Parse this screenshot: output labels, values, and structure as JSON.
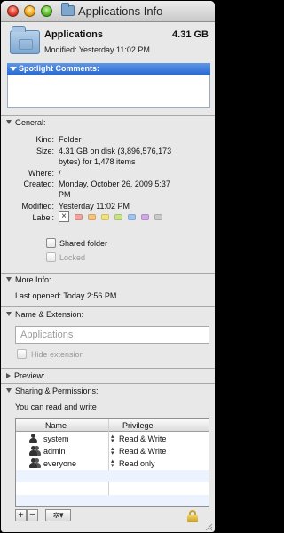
{
  "window": {
    "title": "Applications Info"
  },
  "header": {
    "name": "Applications",
    "size": "4.31 GB",
    "modified": "Modified: Yesterday 11:02 PM"
  },
  "spotlight": {
    "label": "Spotlight Comments:",
    "comment": ""
  },
  "general": {
    "heading": "General:",
    "kind_label": "Kind:",
    "kind": "Folder",
    "size_label": "Size:",
    "size_line1": "4.31 GB on disk (3,896,576,173",
    "size_line2": "bytes) for 1,478 items",
    "where_label": "Where:",
    "where": "/",
    "created_label": "Created:",
    "created_line1": "Monday, October 26, 2009 5:37",
    "created_line2": "PM",
    "modified_label": "Modified:",
    "modified": "Yesterday 11:02 PM",
    "label_label": "Label:",
    "label_colors": [
      "#f2a39e",
      "#f6c27c",
      "#f2e27c",
      "#c7e28a",
      "#9fc4f2",
      "#cfa9e6",
      "#c9c9c9"
    ],
    "shared_folder": "Shared folder",
    "locked": "Locked"
  },
  "more_info": {
    "heading": "More Info:",
    "last_opened": "Last opened: Today 2:56 PM"
  },
  "name_ext": {
    "heading": "Name & Extension:",
    "name_value": "Applications",
    "hide_extension": "Hide extension"
  },
  "preview": {
    "heading": "Preview:"
  },
  "sharing": {
    "heading": "Sharing & Permissions:",
    "summary": "You can read and write",
    "col_name": "Name",
    "col_privilege": "Privilege",
    "rows": [
      {
        "name": "system",
        "privilege": "Read & Write",
        "icon": "user-icon"
      },
      {
        "name": "admin",
        "privilege": "Read & Write",
        "icon": "group-icon"
      },
      {
        "name": "everyone",
        "privilege": "Read only",
        "icon": "group-icon"
      }
    ],
    "add_label": "+",
    "remove_label": "−",
    "action_label": "✲▾"
  }
}
